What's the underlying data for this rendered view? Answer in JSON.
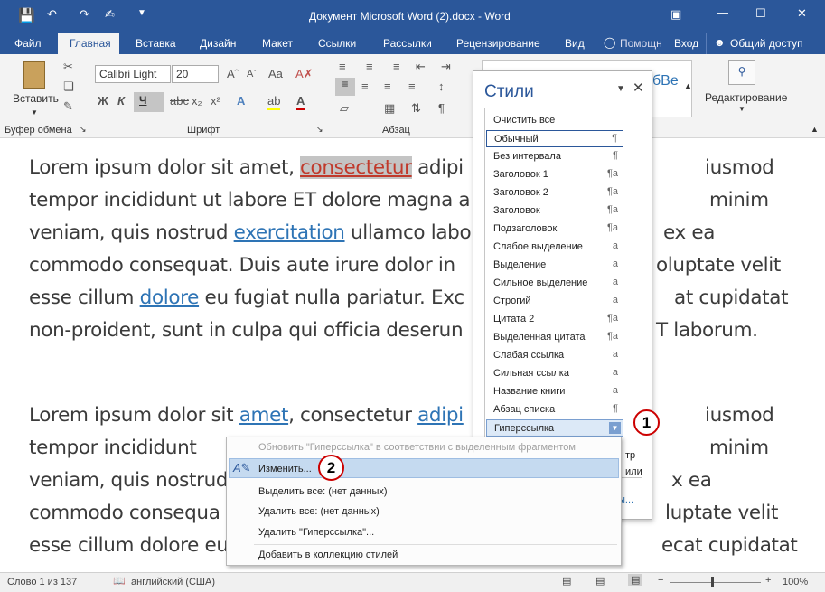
{
  "window": {
    "title": "Документ Microsoft Word (2).docx - Word"
  },
  "tabs": [
    "Файл",
    "Главная",
    "Вставка",
    "Дизайн",
    "Макет",
    "Ссылки",
    "Рассылки",
    "Рецензирование",
    "Вид"
  ],
  "tab_active": "Главная",
  "tell_me": "Помощн",
  "signin": "Вход",
  "share": "Общий доступ",
  "ribbon": {
    "paste": "Вставить",
    "font_name": "Calibri Light",
    "font_size": "20",
    "group_clipboard": "Буфер обмена",
    "group_font": "Шрифт",
    "group_paragraph": "Абзац",
    "editing": "Редактирование",
    "gallery_sample": "бВе"
  },
  "document": {
    "lines": [
      [
        "Lorem ipsum dolor sit amet, ",
        "consectetur",
        " adipi",
        "",
        "iusmod"
      ],
      [
        "tempor incididunt ut labore ET dolore magna a",
        "",
        "minim"
      ],
      [
        "veniam, quis nostrud ",
        "exercitation",
        " ullamco labo",
        "ex ea"
      ],
      [
        "commodo consequat. Duis aute irure dolor in",
        "oluptate velit"
      ],
      [
        "esse cillum ",
        "dolore",
        " eu fugiat nulla pariatur. Exc",
        "at cupidatat"
      ],
      [
        "non-proident, sunt in culpa qui officia deserun",
        "T laborum."
      ],
      [
        "Lorem ipsum dolor sit ",
        "amet",
        ", consectetur ",
        "adipi",
        "iusmod"
      ],
      [
        "tempor incididunt",
        "minim"
      ],
      [
        "veniam, quis nostrud",
        "x ea"
      ],
      [
        "commodo consequa",
        "luptate velit"
      ],
      [
        "esse cillum dolore eu",
        "ecat cupidatat"
      ]
    ]
  },
  "styles_pane": {
    "title": "Стили",
    "clear_all": "Очистить все",
    "items": [
      {
        "name": "Обычный",
        "mark": "¶"
      },
      {
        "name": "Без интервала",
        "mark": "¶"
      },
      {
        "name": "Заголовок 1",
        "mark": "¶a"
      },
      {
        "name": "Заголовок 2",
        "mark": "¶a"
      },
      {
        "name": "Заголовок",
        "mark": "¶a"
      },
      {
        "name": "Подзаголовок",
        "mark": "¶a"
      },
      {
        "name": "Слабое выделение",
        "mark": "a"
      },
      {
        "name": "Выделение",
        "mark": "a"
      },
      {
        "name": "Сильное выделение",
        "mark": "a"
      },
      {
        "name": "Строгий",
        "mark": "a"
      },
      {
        "name": "Цитата 2",
        "mark": "¶a"
      },
      {
        "name": "Выделенная цитата",
        "mark": "¶a"
      },
      {
        "name": "Слабая ссылка",
        "mark": "a"
      },
      {
        "name": "Сильная ссылка",
        "mark": "a"
      },
      {
        "name": "Название книги",
        "mark": "a"
      },
      {
        "name": "Абзац списка",
        "mark": "¶"
      },
      {
        "name": "Гиперссылка",
        "mark": ""
      }
    ],
    "partial_right": [
      "тр",
      "или",
      "ы..."
    ]
  },
  "context_menu": {
    "update": "Обновить \"Гиперссылка\" в соответствии с выделенным фрагментом",
    "modify": "Изменить...",
    "select_all": "Выделить все: (нет данных)",
    "delete_all": "Удалить все: (нет данных)",
    "delete_style": "Удалить \"Гиперссылка\"...",
    "add_gallery": "Добавить в коллекцию стилей"
  },
  "badges": [
    "1",
    "2"
  ],
  "status": {
    "words": "Слово 1 из 137",
    "language": "английский (США)",
    "zoom": "100%"
  }
}
